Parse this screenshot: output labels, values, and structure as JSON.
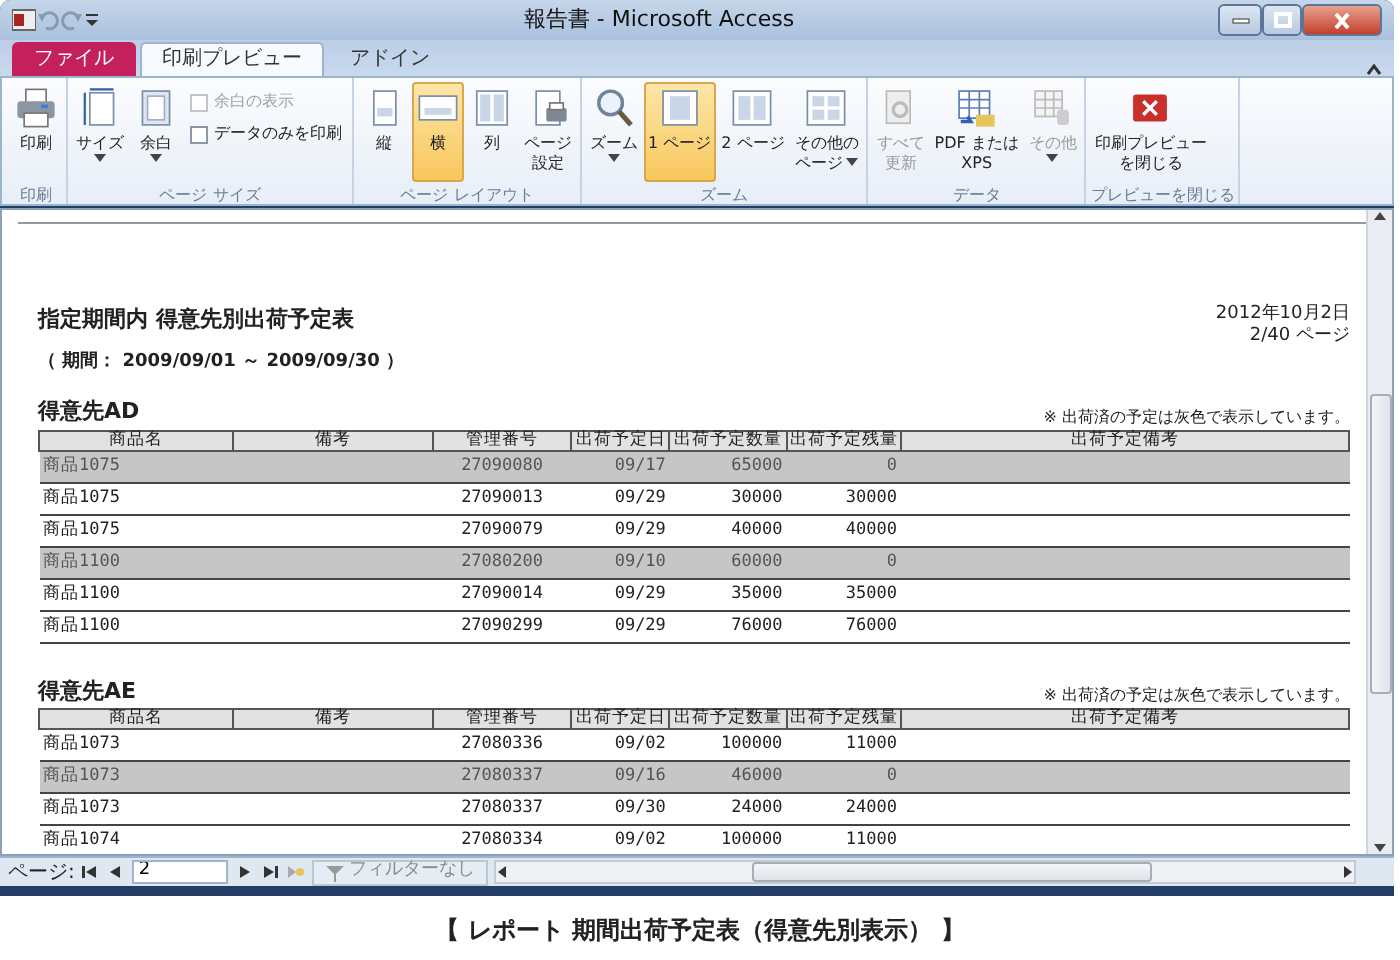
{
  "window": {
    "title": "報告書 - Microsoft Access"
  },
  "tabs": [
    {
      "label": "ファイル",
      "kind": "file",
      "selected": false
    },
    {
      "label": "印刷プレビュー",
      "kind": "tab",
      "selected": true
    },
    {
      "label": "アドイン",
      "kind": "tab",
      "selected": false
    }
  ],
  "ribbon": {
    "groups": [
      {
        "label": "印刷",
        "items": [
          {
            "kind": "large",
            "label": "印刷",
            "selected": false,
            "disabled": false,
            "menu": false
          }
        ]
      },
      {
        "label": "ページ サイズ",
        "items": [
          {
            "kind": "large",
            "label": "サイズ",
            "selected": false,
            "disabled": false,
            "menu": true
          },
          {
            "kind": "large",
            "label": "余白",
            "selected": false,
            "disabled": false,
            "menu": true
          },
          {
            "kind": "checks",
            "checks": [
              {
                "label": "余白の表示",
                "checked": false,
                "disabled": true
              },
              {
                "label": "データのみを印刷",
                "checked": false,
                "disabled": false
              }
            ]
          }
        ]
      },
      {
        "label": "ページ レイアウト",
        "items": [
          {
            "kind": "large",
            "label": "縦",
            "selected": false,
            "disabled": false,
            "menu": false
          },
          {
            "kind": "large",
            "label": "横",
            "selected": true,
            "disabled": false,
            "menu": false
          },
          {
            "kind": "large",
            "label": "列",
            "selected": false,
            "disabled": false,
            "menu": false
          },
          {
            "kind": "large",
            "label": [
              "ページ",
              "設定"
            ],
            "selected": false,
            "disabled": false,
            "menu": false
          }
        ]
      },
      {
        "label": "ズーム",
        "items": [
          {
            "kind": "large",
            "label": "ズーム",
            "selected": false,
            "disabled": false,
            "menu": true
          },
          {
            "kind": "large",
            "label": "1 ページ",
            "selected": true,
            "disabled": false,
            "menu": false
          },
          {
            "kind": "large",
            "label": "2 ページ",
            "selected": false,
            "disabled": false,
            "menu": false
          },
          {
            "kind": "large",
            "label": [
              "その他の",
              "ページ"
            ],
            "selected": false,
            "disabled": false,
            "menu": true
          }
        ]
      },
      {
        "label": "データ",
        "items": [
          {
            "kind": "large",
            "label": [
              "すべて",
              "更新"
            ],
            "selected": false,
            "disabled": true,
            "menu": false
          },
          {
            "kind": "large",
            "label": [
              "PDF または",
              "XPS"
            ],
            "selected": false,
            "disabled": false,
            "menu": false
          },
          {
            "kind": "large",
            "label": "その他",
            "selected": false,
            "disabled": true,
            "menu": true
          }
        ]
      },
      {
        "label": "プレビューを閉じる",
        "items": [
          {
            "kind": "large",
            "label": [
              "印刷プレビュー",
              "を閉じる"
            ],
            "selected": false,
            "disabled": false,
            "menu": false
          }
        ]
      }
    ]
  },
  "report": {
    "title": "指定期間内 得意先別出荷予定表",
    "period": "（ 期間： 2009/09/01 ～ 2009/09/30 ）",
    "date": "2012年10月2日",
    "page_info": "2/40 ページ",
    "sections": [
      {
        "customer": "得意先AD",
        "note": "※ 出荷済の予定は灰色で表示しています。",
        "columns": [
          "商品名",
          "備考",
          "管理番号",
          "出荷予定日",
          "出荷予定数量",
          "出荷予定残量",
          "出荷予定備考"
        ],
        "rows": [
          {
            "shipped": true,
            "product": "商品1075",
            "number": "27090080",
            "date": "09/17",
            "quantity": "65000",
            "remaining": "0"
          },
          {
            "shipped": false,
            "product": "商品1075",
            "number": "27090013",
            "date": "09/29",
            "quantity": "30000",
            "remaining": "30000"
          },
          {
            "shipped": false,
            "product": "商品1075",
            "number": "27090079",
            "date": "09/29",
            "quantity": "40000",
            "remaining": "40000"
          },
          {
            "shipped": true,
            "product": "商品1100",
            "number": "27080200",
            "date": "09/10",
            "quantity": "60000",
            "remaining": "0"
          },
          {
            "shipped": false,
            "product": "商品1100",
            "number": "27090014",
            "date": "09/29",
            "quantity": "35000",
            "remaining": "35000"
          },
          {
            "shipped": false,
            "product": "商品1100",
            "number": "27090299",
            "date": "09/29",
            "quantity": "76000",
            "remaining": "76000"
          }
        ]
      },
      {
        "customer": "得意先AE",
        "note": "※ 出荷済の予定は灰色で表示しています。",
        "columns": [
          "商品名",
          "備考",
          "管理番号",
          "出荷予定日",
          "出荷予定数量",
          "出荷予定残量",
          "出荷予定備考"
        ],
        "rows": [
          {
            "shipped": false,
            "product": "商品1073",
            "number": "27080336",
            "date": "09/02",
            "quantity": "100000",
            "remaining": "11000"
          },
          {
            "shipped": true,
            "product": "商品1073",
            "number": "27080337",
            "date": "09/16",
            "quantity": "46000",
            "remaining": "0"
          },
          {
            "shipped": false,
            "product": "商品1073",
            "number": "27080337",
            "date": "09/30",
            "quantity": "24000",
            "remaining": "24000"
          },
          {
            "shipped": false,
            "product": "商品1074",
            "number": "27080334",
            "date": "09/02",
            "quantity": "100000",
            "remaining": "11000"
          }
        ]
      }
    ]
  },
  "status_bar": {
    "label": "ページ:",
    "page": "2",
    "filter": "フィルターなし"
  },
  "caption": "【 レポート 期間出荷予定表（得意先別表示） 】"
}
